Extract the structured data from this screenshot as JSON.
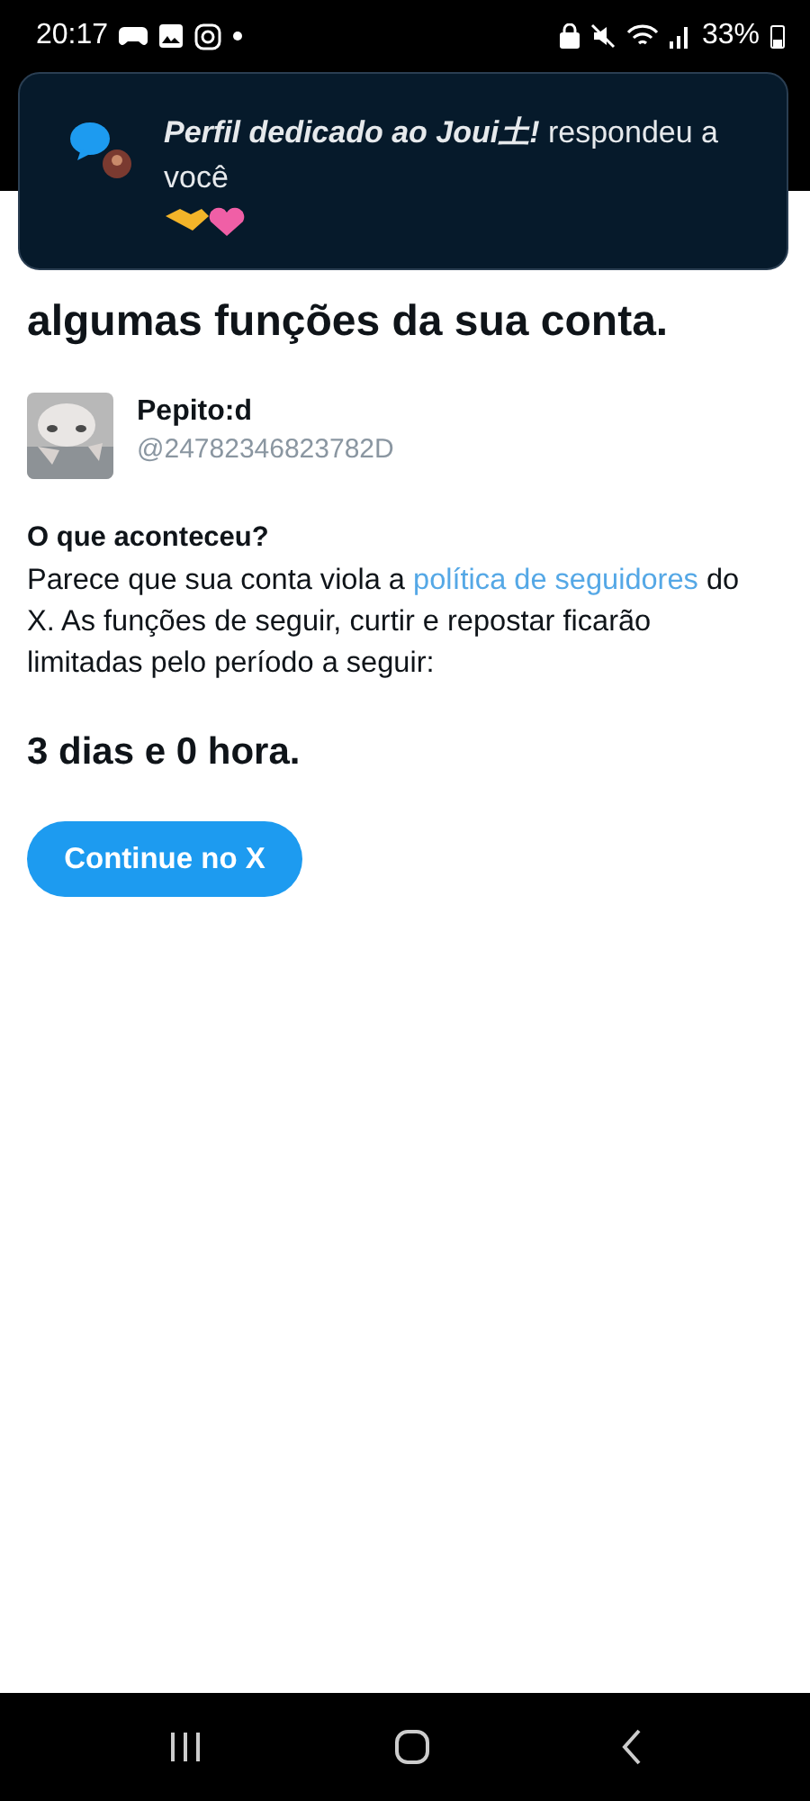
{
  "status_bar": {
    "time": "20:17",
    "battery": "33%"
  },
  "notification": {
    "message": "**Perfil dedicado ao Joui土!** respondeu a você"
  },
  "title": {
    "line_2": "algumas funções da sua conta."
  },
  "account": {
    "name": "Pepito:d",
    "handle": "@24782346823782D"
  },
  "section": {
    "heading": "O que aconteceu?",
    "text_before": "Parece que sua conta viola a",
    "link": "política de seguidores",
    "text_after": "do X. As funções de seguir, curtir e repostar ficarão limitadas pelo período a seguir:"
  },
  "duration": "3 dias e 0 hora.",
  "button": {
    "label": "Continue no X"
  }
}
